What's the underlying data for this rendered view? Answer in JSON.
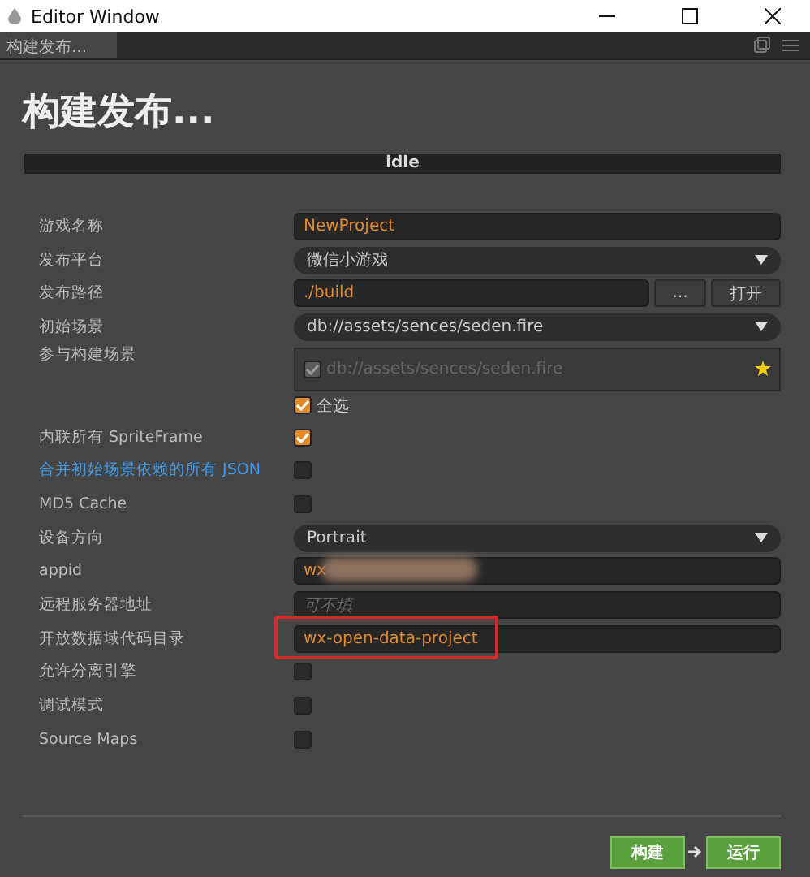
{
  "window": {
    "title": "Editor Window"
  },
  "tab": {
    "label": "构建发布...",
    "selected": true
  },
  "heading": "构建发布...",
  "status": "idle",
  "fields": [
    {
      "kind": "text",
      "label": "游戏名称",
      "value": "NewProject"
    },
    {
      "kind": "select",
      "label": "发布平台",
      "value": "微信小游戏"
    },
    {
      "kind": "path",
      "label": "发布路径",
      "value": "./build",
      "buttons": [
        "...",
        "打开"
      ]
    },
    {
      "kind": "select",
      "label": "初始场景",
      "value": "db://assets/sences/seden.fire"
    },
    {
      "kind": "scenes",
      "label": "参与构建场景",
      "scenes": [
        {
          "path": "db://assets/sences/seden.fire",
          "checked": true
        }
      ],
      "select_all": {
        "label": "全选",
        "checked": true
      }
    },
    {
      "kind": "checkbox",
      "label": "内联所有 SpriteFrame",
      "checked": true
    },
    {
      "kind": "checkbox",
      "label": "合并初始场景依赖的所有 JSON",
      "link": true,
      "checked": false
    },
    {
      "kind": "checkbox",
      "label": "MD5 Cache",
      "checked": false
    },
    {
      "kind": "select",
      "label": "设备方向",
      "value": "Portrait"
    },
    {
      "kind": "text",
      "label": "appid",
      "value": "wx",
      "redacted": true
    },
    {
      "kind": "text",
      "label": "远程服务器地址",
      "placeholder": "可不填"
    },
    {
      "kind": "text",
      "label": "开放数据域代码目录",
      "value": "wx-open-data-project",
      "highlighted": true
    },
    {
      "kind": "checkbox",
      "label": "允许分离引擎",
      "checked": false
    },
    {
      "kind": "checkbox",
      "label": "调试模式",
      "checked": false
    },
    {
      "kind": "checkbox",
      "label": "Source Maps",
      "checked": false
    }
  ],
  "actions": [
    "构建",
    "运行"
  ]
}
